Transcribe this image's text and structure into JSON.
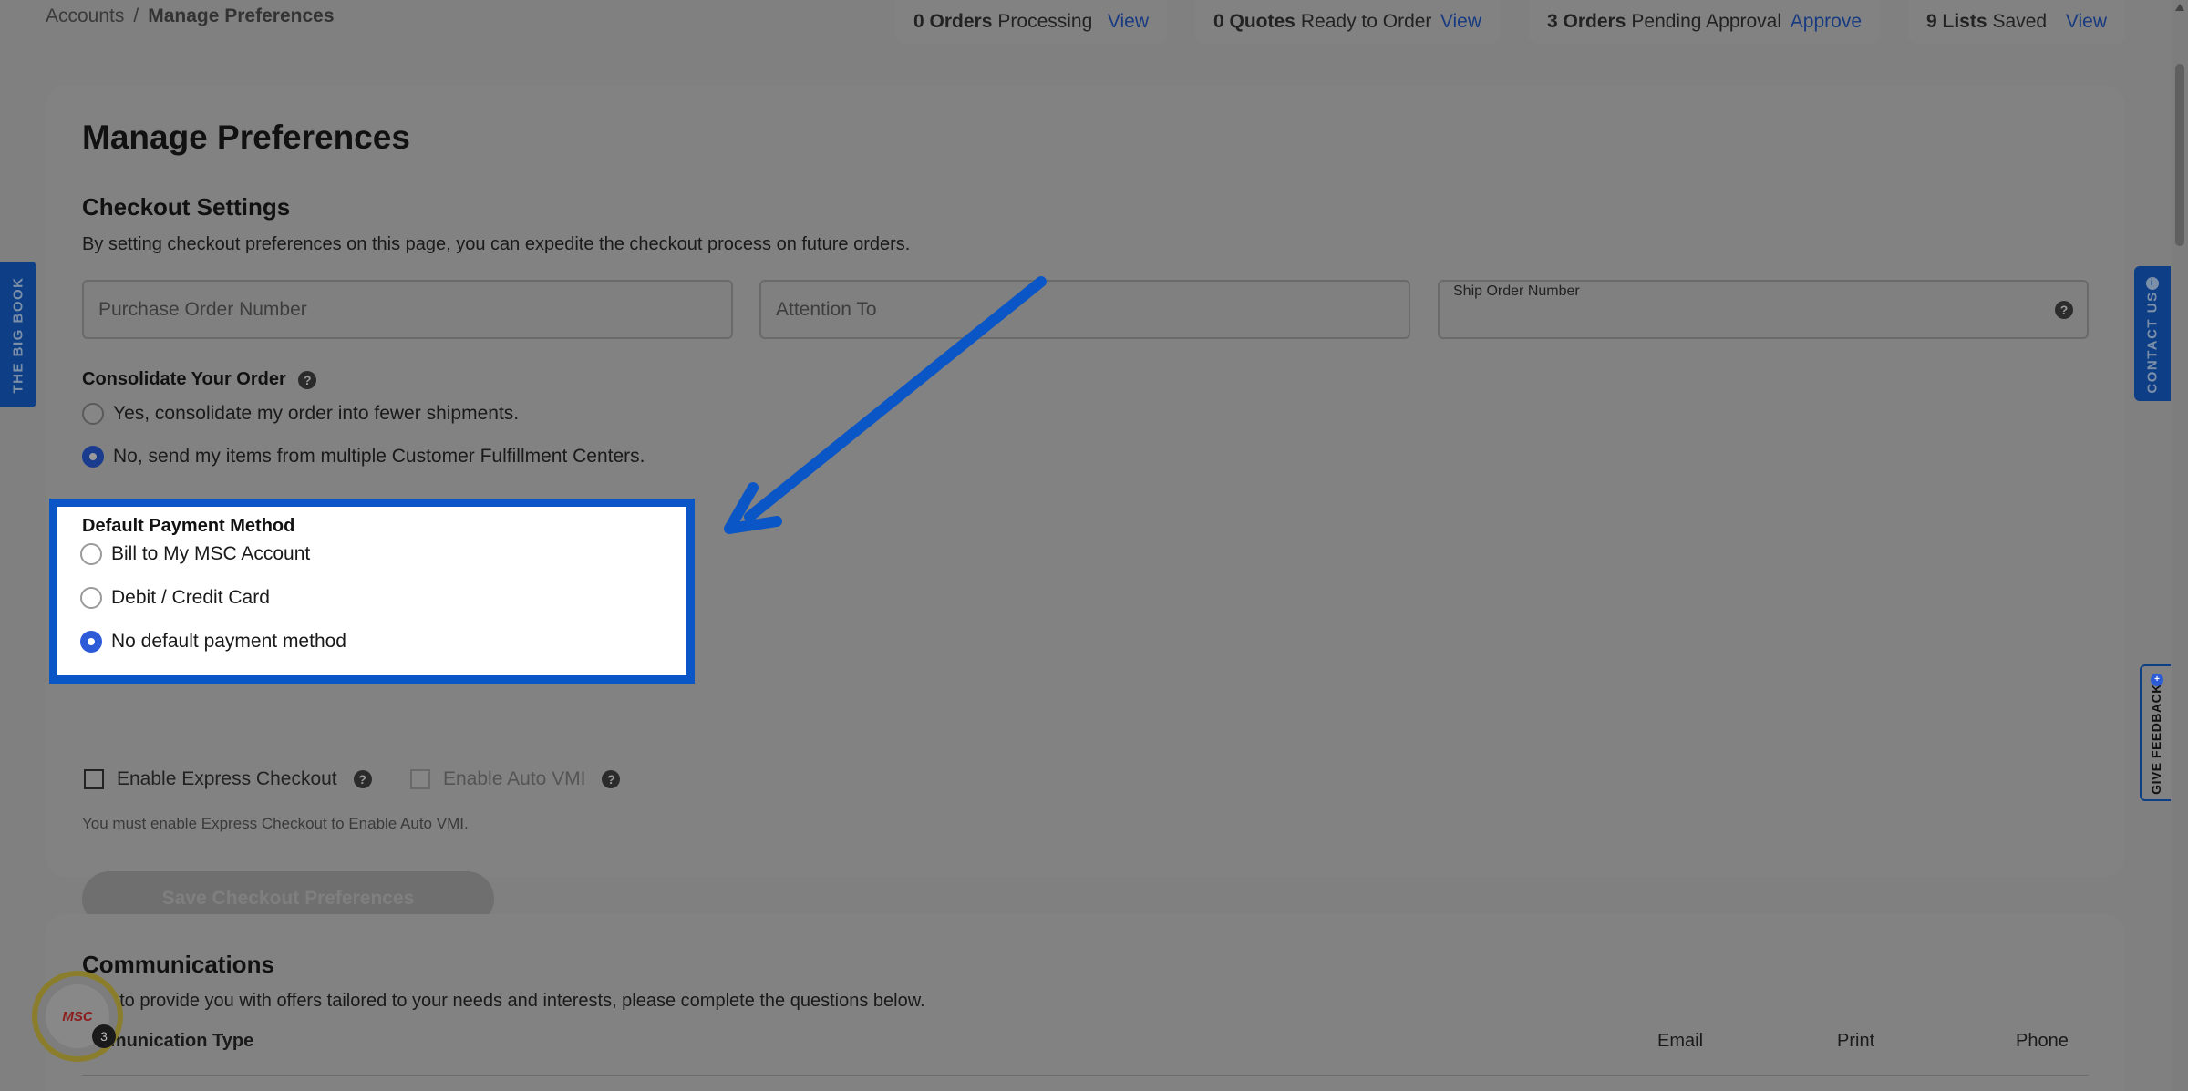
{
  "breadcrumb": {
    "root": "Accounts",
    "separator": "/",
    "current": "Manage Preferences"
  },
  "stats": [
    {
      "count": "0 Orders",
      "label": "Processing",
      "link": "View"
    },
    {
      "count": "0 Quotes",
      "label": "Ready to Order",
      "link": "View"
    },
    {
      "count": "3 Orders",
      "label": "Pending Approval",
      "link": "Approve"
    },
    {
      "count": "9 Lists",
      "label": "Saved",
      "link": "View"
    }
  ],
  "page": {
    "title": "Manage Preferences",
    "checkout": {
      "title": "Checkout Settings",
      "description": "By setting checkout preferences on this page, you can expedite the checkout process on future orders.",
      "fields": {
        "po_placeholder": "Purchase Order Number",
        "attention_placeholder": "Attention To",
        "ship_order_label": "Ship Order Number"
      },
      "consolidate": {
        "label": "Consolidate Your Order",
        "options": [
          {
            "label": "Yes, consolidate my order into fewer shipments.",
            "selected": false
          },
          {
            "label": "No, send my items from multiple Customer Fulfillment Centers.",
            "selected": true
          }
        ]
      },
      "payment": {
        "label": "Default Payment Method",
        "options": [
          {
            "label": "Bill to My MSC Account",
            "selected": false
          },
          {
            "label": "Debit / Credit Card",
            "selected": false
          },
          {
            "label": "No default payment method",
            "selected": true
          }
        ]
      },
      "express_checkout_label": "Enable Express Checkout",
      "auto_vmi_label": "Enable Auto VMI",
      "note": "You must enable Express Checkout to Enable Auto VMI.",
      "save_label": "Save Checkout Preferences"
    },
    "communications": {
      "title": "Communications",
      "description": "rder to provide you with offers tailored to your needs and interests, please complete the questions below.",
      "type_header": "mmunication Type",
      "columns": [
        "Email",
        "Print",
        "Phone"
      ]
    }
  },
  "side_tabs": {
    "big_book": "THE BIG BOOK",
    "contact": "CONTACT US",
    "feedback": "GIVE FEEDBACK"
  },
  "badge": {
    "logo": "MSC",
    "count": "3"
  },
  "icons": {
    "help": "question-circle-icon",
    "info": "info-icon",
    "arrow": "annotation-arrow-icon"
  },
  "colors": {
    "highlight": "#0a56c6",
    "accent": "#1a3c8f"
  }
}
